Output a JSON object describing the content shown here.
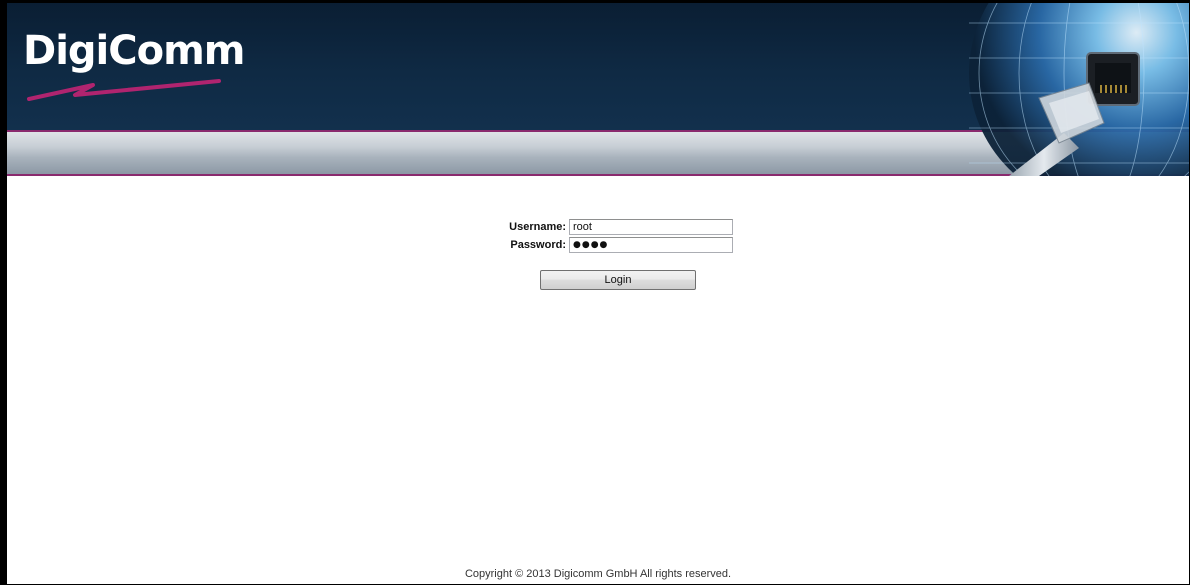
{
  "header": {
    "logo_text": "DigiComm"
  },
  "login": {
    "username_label": "Username:",
    "username_value": "root",
    "password_label": "Password:",
    "password_masked": "●●●●",
    "login_button": "Login"
  },
  "footer": {
    "copyright": "Copyright © 2013 Digicomm GmbH All rights reserved."
  },
  "colors": {
    "header_dark": "#0c2238",
    "accent_magenta": "#8a2a6e",
    "band_gray": "#a9b3bd"
  },
  "icons": {
    "logo": "digicomm-logo",
    "banner_art": "globe-ethernet-cable-image"
  }
}
